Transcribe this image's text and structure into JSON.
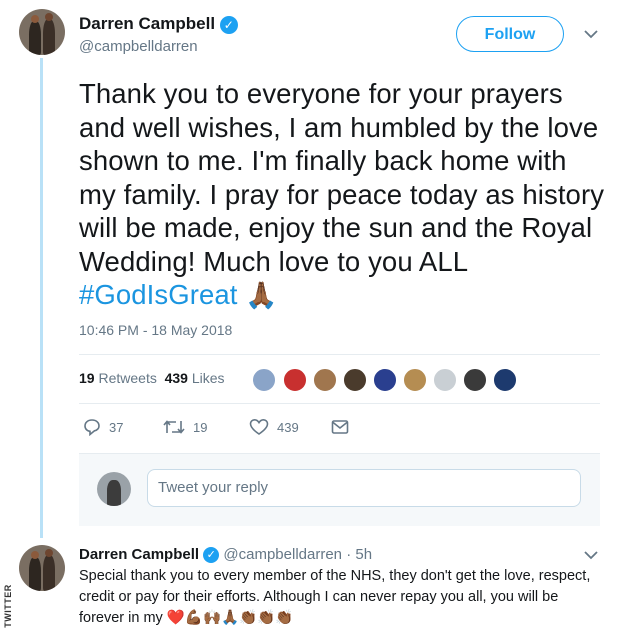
{
  "main_tweet": {
    "author_name": "Darren Campbell",
    "handle": "@campbelldarren",
    "follow_label": "Follow",
    "text": "Thank you to everyone for your prayers and well wishes, I am humbled by the love shown to me. I'm finally back home with my family. I pray for peace today as history will be made, enjoy the sun and the Royal Wedding! Much love to you ALL ",
    "hashtag": "#GodIsGreat",
    "emoji": "🙏🏾",
    "timestamp": "10:46 PM - 18 May 2018",
    "retweets_count": "19",
    "retweets_label": "Retweets",
    "likes_count": "439",
    "likes_label": "Likes",
    "actions": {
      "reply_count": "37",
      "retweet_count": "19",
      "like_count": "439"
    },
    "icons": [
      "verified-icon",
      "chevron-down-icon",
      "reply-icon",
      "retweet-icon",
      "heart-icon",
      "message-icon"
    ]
  },
  "reply_box": {
    "placeholder": "Tweet your reply"
  },
  "reply_tweet": {
    "author_name": "Darren Campbell",
    "handle": "@campbelldarren",
    "time": "· 5h",
    "text": "Special thank you to every member of the NHS, they don't get the love, respect, credit or pay for their efforts. Although I can never repay you all, you will be forever in my ",
    "emojis": "❤️💪🏾🙌🏾🙏🏾👏🏾👏🏾👏🏾"
  },
  "watermark": "TWITTER",
  "colors": {
    "accent": "#1da1f2",
    "hashtag": "#1b95e0",
    "thread_line": "#b9e1f7",
    "muted_text": "#657786"
  }
}
